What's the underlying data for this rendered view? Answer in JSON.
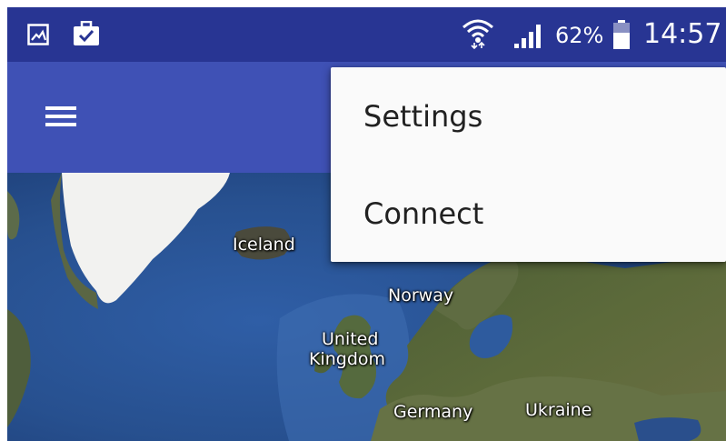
{
  "status_bar": {
    "battery_percent": "62%",
    "time": "14:57",
    "icons": [
      "gallery-icon",
      "briefcase-check-icon",
      "wifi-icon",
      "signal-icon",
      "battery-icon"
    ]
  },
  "app_bar": {
    "menu_icon": "hamburger-icon",
    "color": "#3f51b5"
  },
  "colors": {
    "status_bar": "#283593",
    "app_bar": "#3f51b5",
    "menu_background": "#fafafa",
    "menu_text": "#212121"
  },
  "overflow_menu": {
    "items": [
      {
        "label": "Settings"
      },
      {
        "label": "Connect"
      }
    ]
  },
  "map": {
    "type": "satellite",
    "labels": [
      "Iceland",
      "Norway",
      "United",
      "Kingdom",
      "Germany",
      "Ukraine"
    ]
  }
}
